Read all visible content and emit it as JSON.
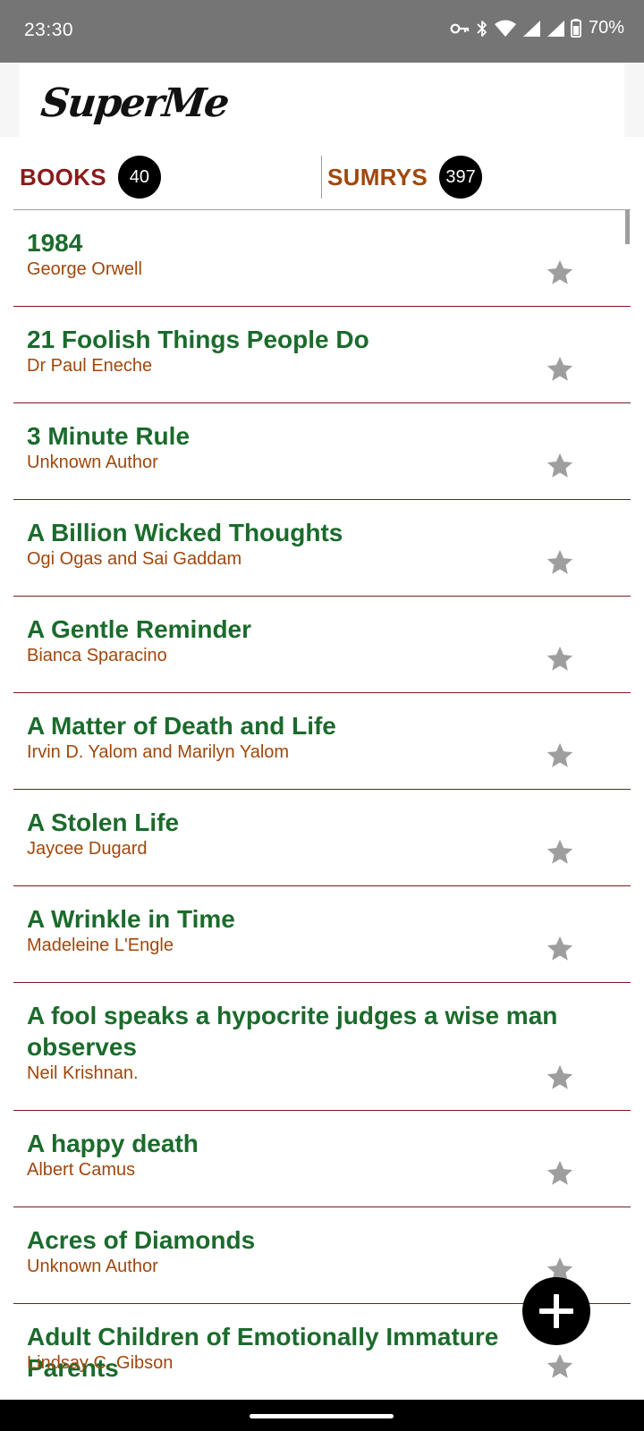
{
  "status_bar": {
    "time": "23:30",
    "battery": "70%",
    "icons": [
      "vpn-key-icon",
      "bluetooth-icon",
      "wifi-icon",
      "cell-signal-icon",
      "cell-signal-icon",
      "battery-icon"
    ]
  },
  "tabs": {
    "books": {
      "label": "BOOKS",
      "count": "40"
    },
    "sumrys": {
      "label": "SUMRYS",
      "count": "397"
    }
  },
  "books": [
    {
      "title": "1984",
      "author": "George Orwell"
    },
    {
      "title": "21 Foolish Things People Do",
      "author": "Dr Paul Eneche"
    },
    {
      "title": "3 Minute Rule",
      "author": "Unknown Author"
    },
    {
      "title": "A Billion Wicked Thoughts",
      "author": "Ogi Ogas and Sai Gaddam"
    },
    {
      "title": "A Gentle Reminder",
      "author": "Bianca Sparacino"
    },
    {
      "title": "A Matter of Death and Life",
      "author": "Irvin D. Yalom and Marilyn Yalom"
    },
    {
      "title": "A Stolen Life",
      "author": "Jaycee Dugard"
    },
    {
      "title": "A Wrinkle in Time",
      "author": "Madeleine L'Engle"
    },
    {
      "title": "A fool speaks a hypocrite judges a wise man observes",
      "author": "Neil Krishnan."
    },
    {
      "title": "A happy death",
      "author": "Albert Camus"
    },
    {
      "title": "Acres of Diamonds",
      "author": "Unknown Author"
    },
    {
      "title": "Adult Children of Emotionally Immature Parents",
      "author": "Lindsay C. Gibson"
    }
  ],
  "colors": {
    "title_green": "#1b6b2c",
    "author_brown": "#a0470c",
    "books_tab_red": "#8b1a1a",
    "divider_maroon": "#7a1c1c",
    "star_gray": "#9e9e9e"
  }
}
